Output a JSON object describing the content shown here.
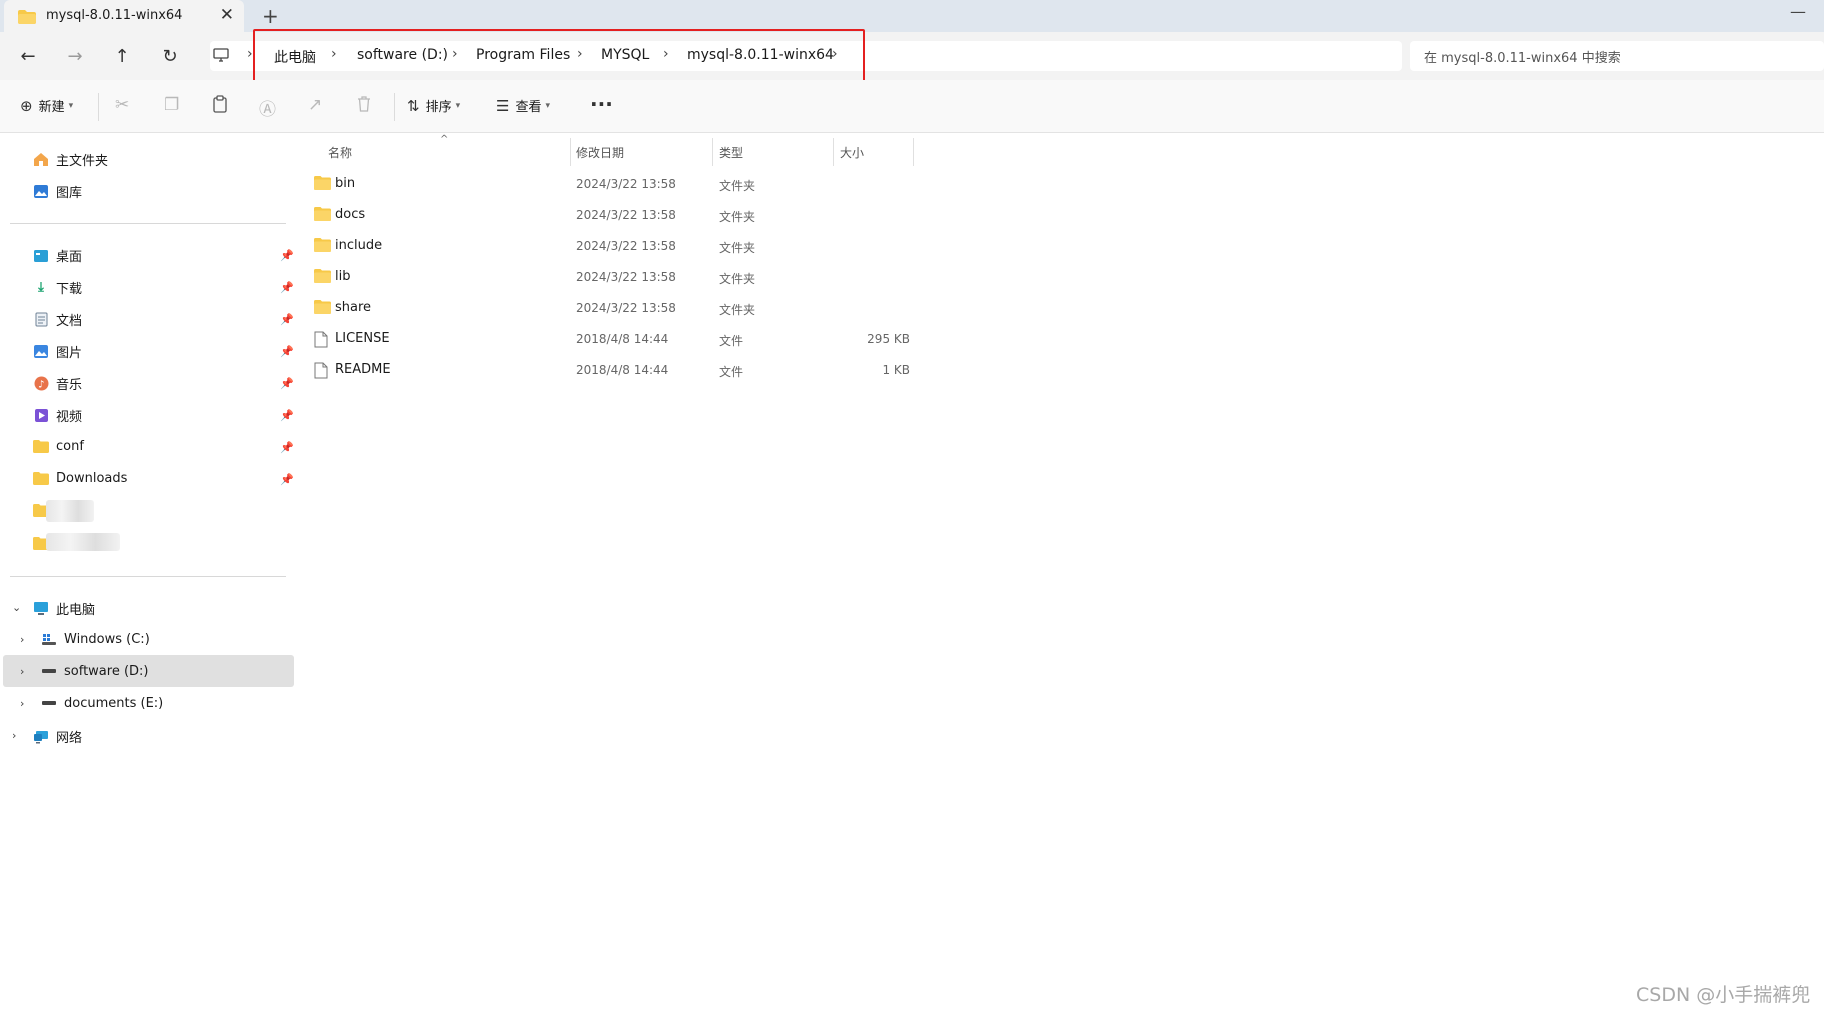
{
  "window": {
    "tab_title": "mysql-8.0.11-winx64",
    "close_glyph": "✕",
    "new_tab_glyph": "+",
    "minimize_glyph": "—"
  },
  "nav": {
    "back_glyph": "←",
    "forward_glyph": "→",
    "up_glyph": "↑",
    "refresh_glyph": "↻"
  },
  "breadcrumb": {
    "items": [
      "此电脑",
      "software (D:)",
      "Program Files",
      "MYSQL",
      "mysql-8.0.11-winx64"
    ],
    "separator": "›"
  },
  "search": {
    "placeholder": "在 mysql-8.0.11-winx64 中搜索"
  },
  "toolbar": {
    "new_label": "新建",
    "sort_label": "排序",
    "view_label": "查看",
    "more_label": "···"
  },
  "sidebar": {
    "quick": [
      {
        "label": "主文件夹",
        "icon": "home-icon"
      },
      {
        "label": "图库",
        "icon": "gallery-icon"
      }
    ],
    "pinned": [
      {
        "label": "桌面",
        "icon": "desktop-icon"
      },
      {
        "label": "下载",
        "icon": "download-icon"
      },
      {
        "label": "文档",
        "icon": "document-icon"
      },
      {
        "label": "图片",
        "icon": "pictures-icon"
      },
      {
        "label": "音乐",
        "icon": "music-icon"
      },
      {
        "label": "视频",
        "icon": "video-icon"
      },
      {
        "label": "conf",
        "icon": "folder-icon"
      },
      {
        "label": "Downloads",
        "icon": "folder-icon"
      }
    ],
    "this_pc": "此电脑",
    "drives": [
      {
        "label": "Windows (C:)",
        "icon": "drive-c-icon"
      },
      {
        "label": "software (D:)",
        "icon": "drive-icon",
        "selected": true
      },
      {
        "label": "documents (E:)",
        "icon": "drive-icon"
      }
    ],
    "network": "网络"
  },
  "file_list": {
    "columns": [
      "名称",
      "修改日期",
      "类型",
      "大小"
    ],
    "rows": [
      {
        "name": "bin",
        "date": "2024/3/22 13:58",
        "type": "文件夹",
        "size": "",
        "kind": "folder"
      },
      {
        "name": "docs",
        "date": "2024/3/22 13:58",
        "type": "文件夹",
        "size": "",
        "kind": "folder"
      },
      {
        "name": "include",
        "date": "2024/3/22 13:58",
        "type": "文件夹",
        "size": "",
        "kind": "folder"
      },
      {
        "name": "lib",
        "date": "2024/3/22 13:58",
        "type": "文件夹",
        "size": "",
        "kind": "folder"
      },
      {
        "name": "share",
        "date": "2024/3/22 13:58",
        "type": "文件夹",
        "size": "",
        "kind": "folder"
      },
      {
        "name": "LICENSE",
        "date": "2018/4/8 14:44",
        "type": "文件",
        "size": "295 KB",
        "kind": "file"
      },
      {
        "name": "README",
        "date": "2018/4/8 14:44",
        "type": "文件",
        "size": "1 KB",
        "kind": "file"
      }
    ]
  },
  "watermark": "CSDN @小手揣裤兜",
  "colors": {
    "highlight_border": "#e42020",
    "folder_yellow": "#f7c948",
    "selected_row": "#e0e0e0"
  }
}
